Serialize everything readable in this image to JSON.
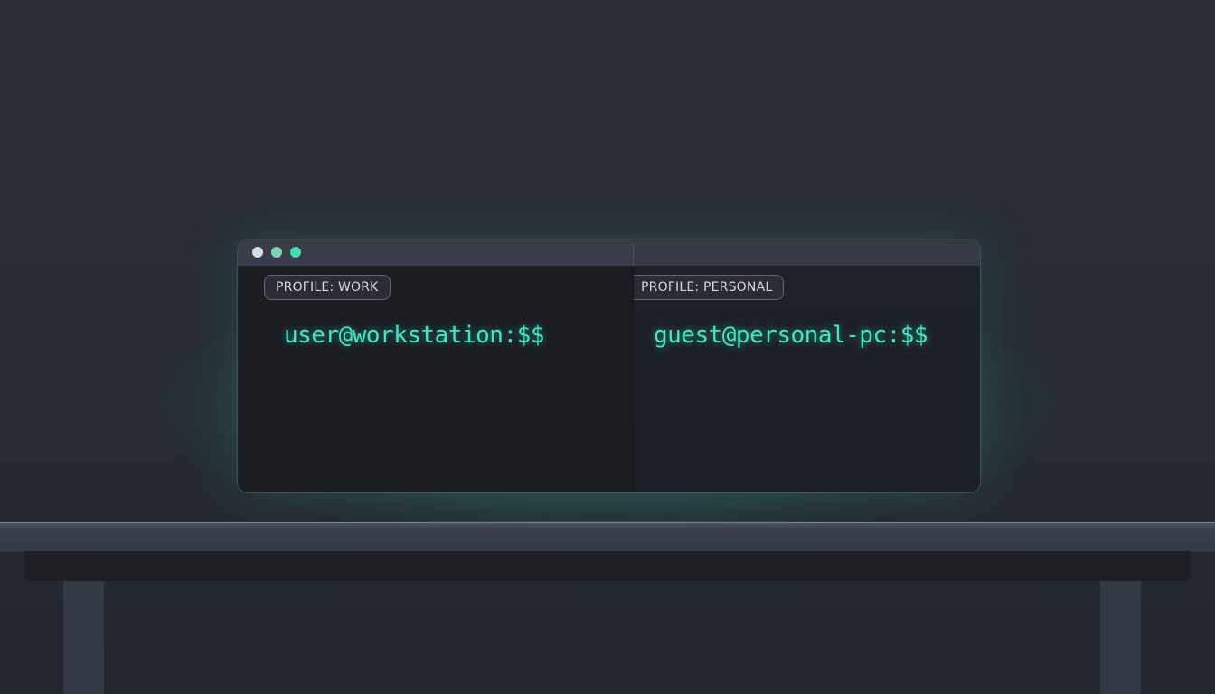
{
  "window": {
    "controls": [
      "close",
      "minimize",
      "maximize"
    ],
    "colors": {
      "close": "#d9dbe0",
      "minimize": "#7fd1b0",
      "maximize": "#3fe0a8"
    }
  },
  "panes": [
    {
      "profile_label": "PROFILE: WORK",
      "prompt": "user@workstation:$$"
    },
    {
      "profile_label": "PROFILE: PERSONAL",
      "prompt": "guest@personal-pc:$$"
    }
  ],
  "colors": {
    "background": "#282b34",
    "terminal_bg": "#1b1d23",
    "accent_prompt": "#3ee6c2"
  }
}
